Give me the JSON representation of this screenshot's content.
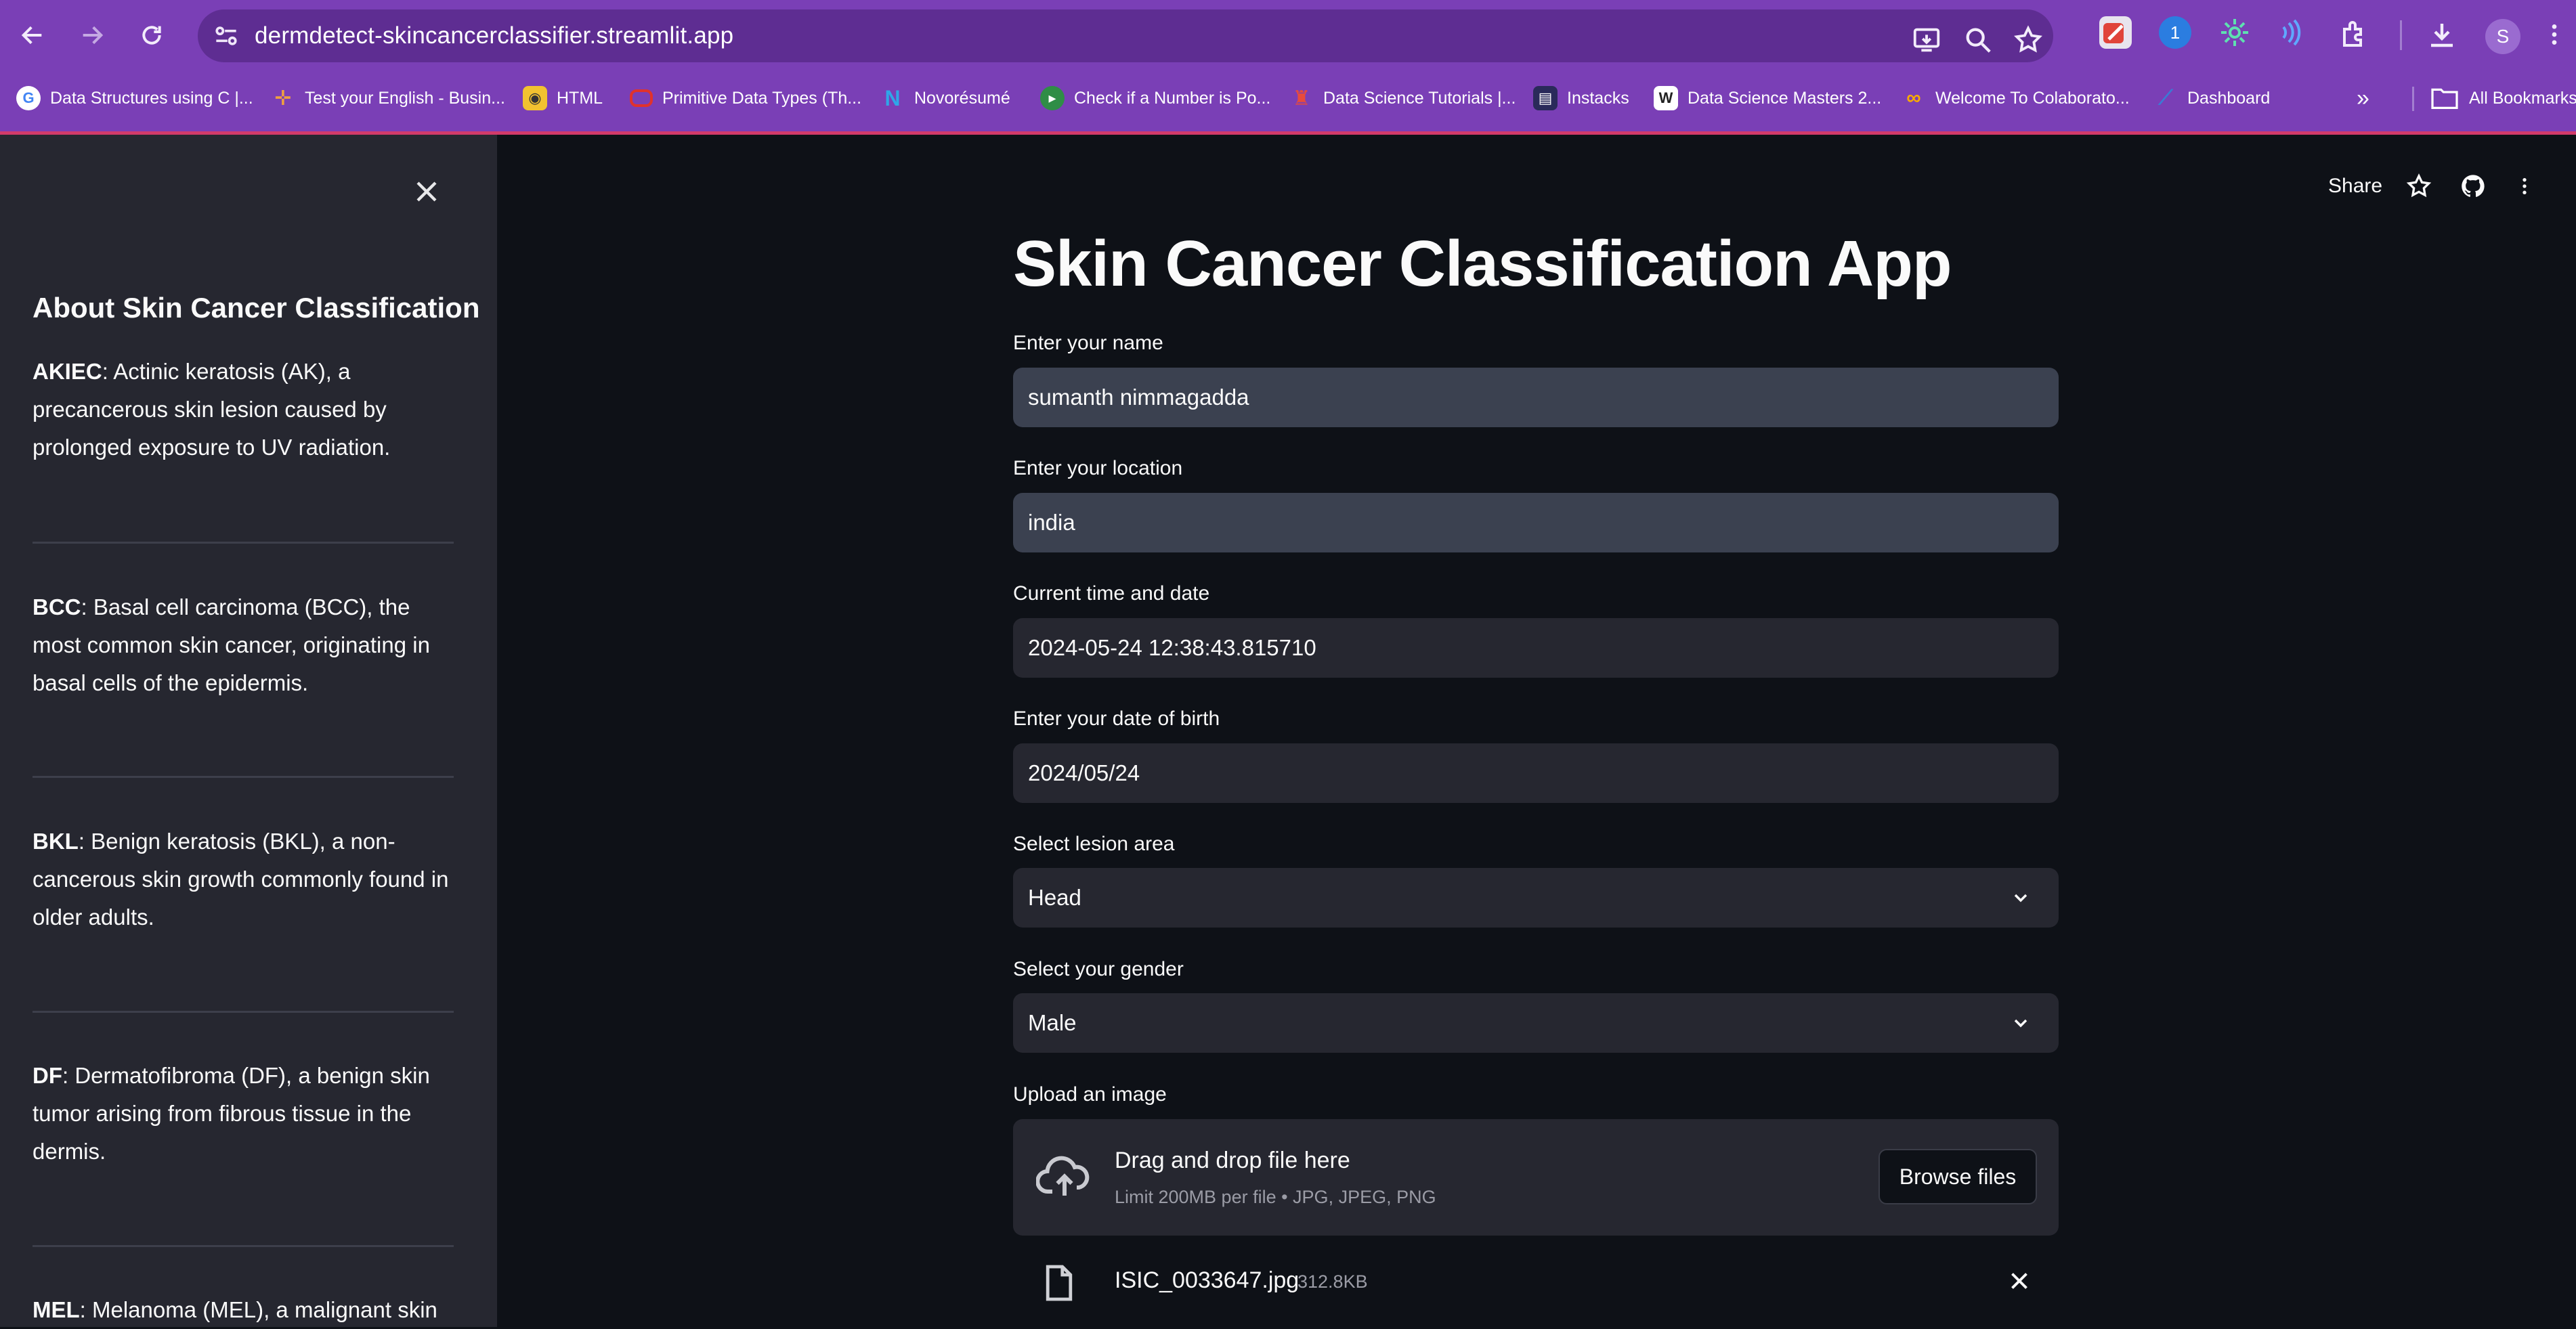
{
  "browser": {
    "url": "dermdetect-skincancerclassifier.streamlit.app",
    "profile_initial": "S",
    "extension_badge": "1",
    "bookmarks": [
      {
        "label": "Data Structures using C |...",
        "icon": "g-icon",
        "color": "#ffffff"
      },
      {
        "label": "Test your English - Busin...",
        "icon": "cross-icon",
        "color": "#f0a040"
      },
      {
        "label": "HTML",
        "icon": "html-icon",
        "color": "#f2c230"
      },
      {
        "label": "Primitive Data Types (Th...",
        "icon": "oracle-icon",
        "color": "#e0322c"
      },
      {
        "label": "Novorésumé",
        "icon": "novoresume-icon",
        "color": "#2fa6e8"
      },
      {
        "label": "Check if a Number is Po...",
        "icon": "gfg-icon",
        "color": "#2f8d46"
      },
      {
        "label": "Data Science Tutorials |...",
        "icon": "flame-icon",
        "color": "#e84b3c"
      },
      {
        "label": "Instacks",
        "icon": "instacks-icon",
        "color": "#2a2a5a"
      },
      {
        "label": "Data Science Masters 2...",
        "icon": "pw-icon",
        "color": "#ffffff"
      },
      {
        "label": "Welcome To Colaborato...",
        "icon": "colab-icon",
        "color": "#f9ab00"
      },
      {
        "label": "Dashboard",
        "icon": "leetcode-icon",
        "color": "#3a7bd5"
      }
    ],
    "all_bookmarks": "All Bookmarks",
    "more": "»"
  },
  "sidebar": {
    "title": "About Skin Cancer Classification",
    "items": [
      {
        "code": "AKIEC",
        "text": ": Actinic keratosis (AK), a precancerous skin lesion caused by prolonged exposure to UV radiation."
      },
      {
        "code": "BCC",
        "text": ": Basal cell carcinoma (BCC), the most common skin cancer, originating in basal cells of the epidermis."
      },
      {
        "code": "BKL",
        "text": ": Benign keratosis (BKL), a non-cancerous skin growth commonly found in older adults."
      },
      {
        "code": "DF",
        "text": ": Dermatofibroma (DF), a benign skin tumor arising from fibrous tissue in the dermis."
      },
      {
        "code": "MEL",
        "text": ": Melanoma (MEL), a malignant skin"
      }
    ]
  },
  "header": {
    "share": "Share"
  },
  "main": {
    "title": "Skin Cancer Classification App",
    "name_label": "Enter your name",
    "name_value": "sumanth nimmagadda",
    "location_label": "Enter your location",
    "location_value": "india",
    "datetime_label": "Current time and date",
    "datetime_value": "2024-05-24 12:38:43.815710",
    "dob_label": "Enter your date of birth",
    "dob_value": "2024/05/24",
    "lesion_label": "Select lesion area",
    "lesion_value": "Head",
    "gender_label": "Select your gender",
    "gender_value": "Male",
    "upload_label": "Upload an image",
    "dropzone_text": "Drag and drop file here",
    "dropzone_limit": "Limit 200MB per file • JPG, JPEG, PNG",
    "browse_label": "Browse files",
    "file_name": "ISIC_0033647.jpg",
    "file_size": "312.8KB"
  }
}
